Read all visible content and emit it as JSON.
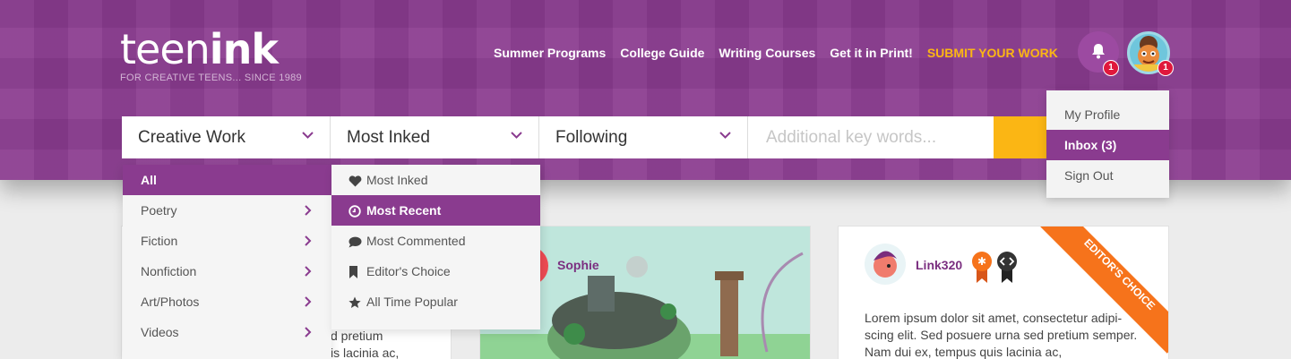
{
  "brand": {
    "logo_light": "teen",
    "logo_bold": "ink",
    "tagline": "FOR CREATIVE TEENS... SINCE 1989"
  },
  "nav": {
    "items": [
      "Summer Programs",
      "College Guide",
      "Writing Courses",
      "Get it in Print!"
    ],
    "submit": "SUBMIT YOUR WORK"
  },
  "notifications": {
    "bell_count": "1",
    "profile_count": "1"
  },
  "search": {
    "category": "Creative Work",
    "sort": "Most Inked",
    "filter": "Following",
    "keywords_placeholder": "Additional key words..."
  },
  "category_menu": [
    "All",
    "Poetry",
    "Fiction",
    "Nonfiction",
    "Art/Photos",
    "Videos"
  ],
  "sort_menu": [
    {
      "label": "Most Inked",
      "icon": "heart-icon"
    },
    {
      "label": "Most Recent",
      "icon": "clock-icon"
    },
    {
      "label": "Most Commented",
      "icon": "comment-icon"
    },
    {
      "label": "Editor's Choice",
      "icon": "bookmark-icon"
    },
    {
      "label": "All Time Popular",
      "icon": "star-icon"
    }
  ],
  "profile_menu": [
    "My Profile",
    "Inbox (3)",
    "Sign Out"
  ],
  "cards": {
    "left_partial": [
      "d pretium",
      "is lacinia ac,"
    ],
    "middle_author": "Sophie",
    "right_author": "Link320",
    "right_ribbon": "EDITOR'S CHOICE",
    "right_body": "Lorem ipsum dolor sit amet, consectetur adipi-scing elit. Sed posuere urna sed pretium semper. Nam dui ex, tempus quis lacinia ac,"
  },
  "colors": {
    "brand_purple": "#8a3b8f",
    "accent_yellow": "#fbb614",
    "badge_red": "#e0183c",
    "ribbon_orange": "#f6731b"
  }
}
